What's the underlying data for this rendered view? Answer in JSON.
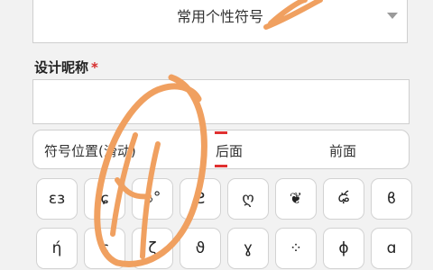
{
  "style_select": {
    "value": "常用个性符号",
    "icon": "chevron-down-icon"
  },
  "nickname": {
    "label": "设计昵称",
    "required_mark": "*",
    "value": ""
  },
  "symbol_position": {
    "label": "符号位置(滑动)",
    "options": [
      "后面",
      "前面"
    ],
    "selected": "后面"
  },
  "symbols": [
    [
      "ɛɜ",
      "ɕ",
      "ঌ°",
      "Ƨ",
      "ღ",
      "❦",
      "ఢ",
      "ϐ"
    ],
    [
      "ή",
      "ɕ",
      "ζ",
      "ϑ",
      "ɣ",
      "⁘",
      "ɸ",
      "ɑ"
    ]
  ],
  "colors": {
    "accent_red": "#e03030",
    "annotation_orange": "#f0a060"
  }
}
